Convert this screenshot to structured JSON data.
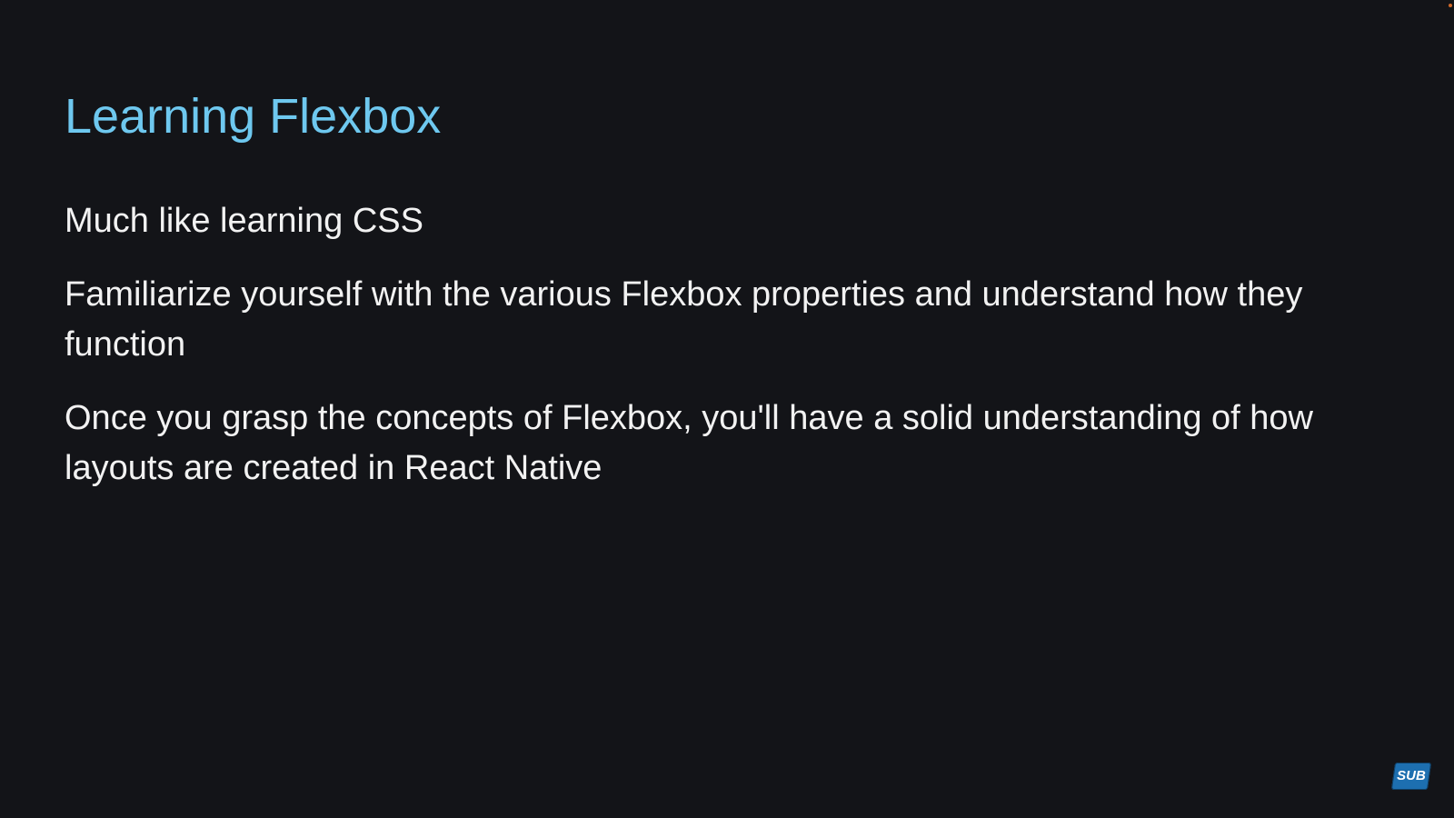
{
  "slide": {
    "title": "Learning Flexbox",
    "bullets": [
      "Much like learning CSS",
      "Familiarize yourself with the various Flexbox properties and understand how they function",
      "Once you grasp the concepts of Flexbox, you'll have a solid understanding of how layouts are created in React Native"
    ]
  },
  "badge": {
    "label": "SUB",
    "icon": "subscribe-icon"
  },
  "colors": {
    "background": "#131418",
    "title": "#6ec8ef",
    "text": "#f2f2f2",
    "badge": "#1d6fb0"
  }
}
